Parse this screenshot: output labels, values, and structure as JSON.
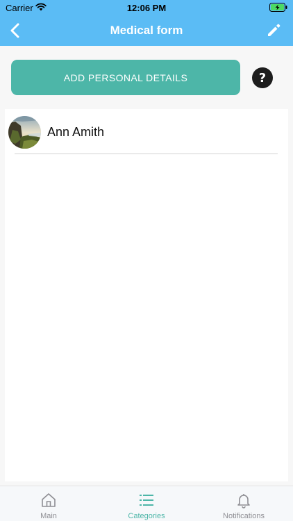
{
  "status_bar": {
    "carrier": "Carrier",
    "time": "12:06 PM"
  },
  "nav": {
    "title": "Medical form"
  },
  "actions": {
    "add_details_label": "ADD PERSONAL DETAILS",
    "help_label": "?"
  },
  "list": {
    "items": [
      {
        "name": "Ann Amith",
        "avatar": "landscape-photo"
      }
    ]
  },
  "tab_bar": {
    "active": "Categories",
    "tabs": [
      {
        "label": "Main",
        "icon": "home-icon"
      },
      {
        "label": "Categories",
        "icon": "list-icon"
      },
      {
        "label": "Notifications",
        "icon": "bell-icon"
      }
    ]
  },
  "colors": {
    "header": "#5bbcf5",
    "primary_button": "#4db6a8",
    "active_tab": "#4db6a8"
  }
}
